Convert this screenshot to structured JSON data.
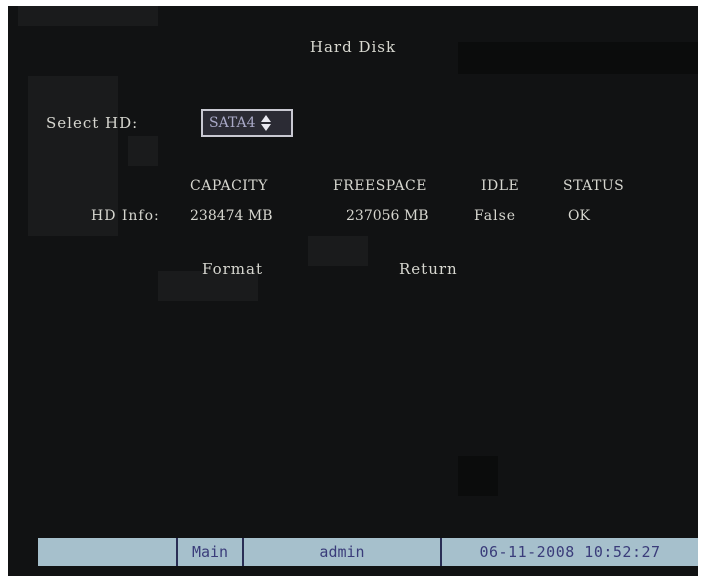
{
  "window": {
    "title": "Hard Disk"
  },
  "select_hd": {
    "label": "Select HD:",
    "value": "SATA4"
  },
  "table": {
    "headers": [
      "CAPACITY",
      "FREESPACE",
      "IDLE",
      "STATUS"
    ],
    "row_label": "HD Info:",
    "row": {
      "capacity": "238474 MB",
      "freespace": "237056 MB",
      "idle": "False",
      "status": "OK"
    }
  },
  "actions": {
    "format": "Format",
    "return": "Return"
  },
  "status_bar": {
    "menu": "Main",
    "user": "admin",
    "datetime": "06-11-2008 10:52:27"
  },
  "colors": {
    "background": "#111213",
    "text": "#d6d6cf",
    "status_bar": "#a6c0cc",
    "status_text": "#3a3c7a"
  },
  "icons": {
    "select_arrows": "up-down-arrows-icon"
  }
}
